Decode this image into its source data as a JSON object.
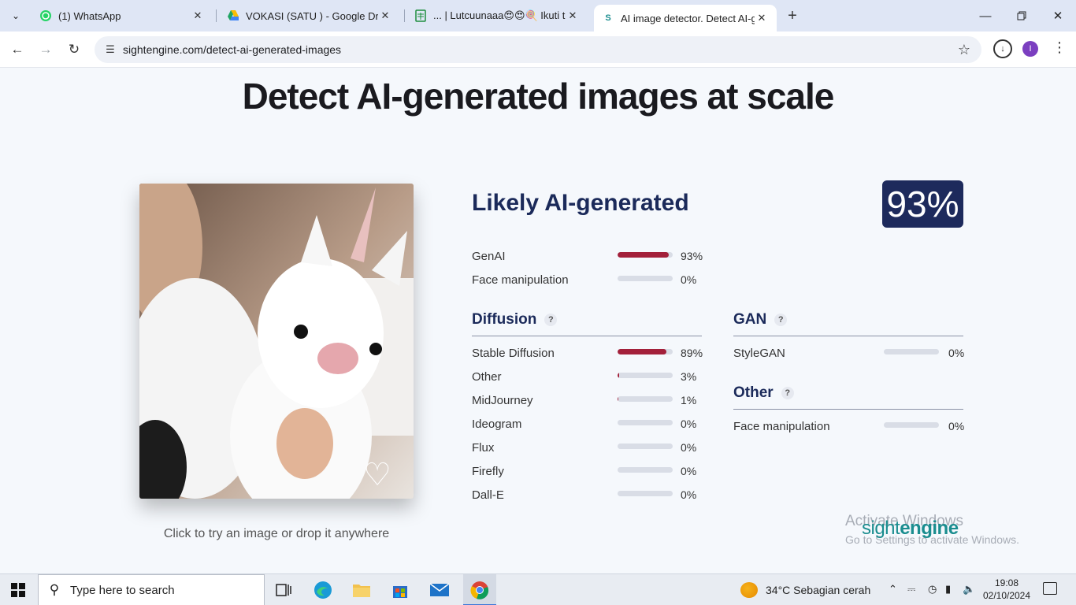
{
  "browser": {
    "tabs": [
      {
        "title": "(1) WhatsApp",
        "favicon": "whatsapp-icon",
        "color": "#25d366"
      },
      {
        "title": "VOKASI (SATU ) - Google Drive",
        "favicon": "google-drive-icon",
        "color": "#1fa463"
      },
      {
        "title": "... | Lutcuunaaa😍😍🍭 Ikuti te",
        "favicon": "sheet-icon",
        "color": "#1e8e3e"
      },
      {
        "title": "AI image detector. Detect AI-ge",
        "favicon": "sightengine-icon",
        "color": "#1a8d8f"
      }
    ],
    "active_tab": 3,
    "url": "sightengine.com/detect-ai-generated-images",
    "profile_initial": "I"
  },
  "page": {
    "headline": "Detect AI-generated images at scale",
    "photo_caption": "Click to try an image or drop it anywhere",
    "verdict": "Likely AI-generated",
    "score": "93%",
    "summary": [
      {
        "label": "GenAI",
        "value": 93,
        "pct": "93%"
      },
      {
        "label": "Face manipulation",
        "value": 0,
        "pct": "0%"
      }
    ],
    "diffusion": {
      "title": "Diffusion",
      "help": "?",
      "items": [
        {
          "label": "Stable Diffusion",
          "value": 89,
          "pct": "89%"
        },
        {
          "label": "Other",
          "value": 3,
          "pct": "3%"
        },
        {
          "label": "MidJourney",
          "value": 1,
          "pct": "1%"
        },
        {
          "label": "Ideogram",
          "value": 0,
          "pct": "0%"
        },
        {
          "label": "Flux",
          "value": 0,
          "pct": "0%"
        },
        {
          "label": "Firefly",
          "value": 0,
          "pct": "0%"
        },
        {
          "label": "Dall-E",
          "value": 0,
          "pct": "0%"
        }
      ]
    },
    "gan": {
      "title": "GAN",
      "help": "?",
      "items": [
        {
          "label": "StyleGAN",
          "value": 0,
          "pct": "0%"
        }
      ]
    },
    "other": {
      "title": "Other",
      "help": "?",
      "items": [
        {
          "label": "Face manipulation",
          "value": 0,
          "pct": "0%"
        }
      ]
    },
    "brand_light": "sight",
    "brand_bold": "engine",
    "activate_line1": "Activate Windows",
    "activate_line2": "Go to Settings to activate Windows."
  },
  "taskbar": {
    "search_placeholder": "Type here to search",
    "weather": "34°C  Sebagian cerah",
    "time": "19:08",
    "date": "02/10/2024"
  },
  "colors": {
    "bar_fill": "#a3203a",
    "bar_track": "#d9dde6",
    "badge": "#1d2a5c",
    "heading": "#1b2a5a",
    "brand": "#1a8d8f"
  }
}
